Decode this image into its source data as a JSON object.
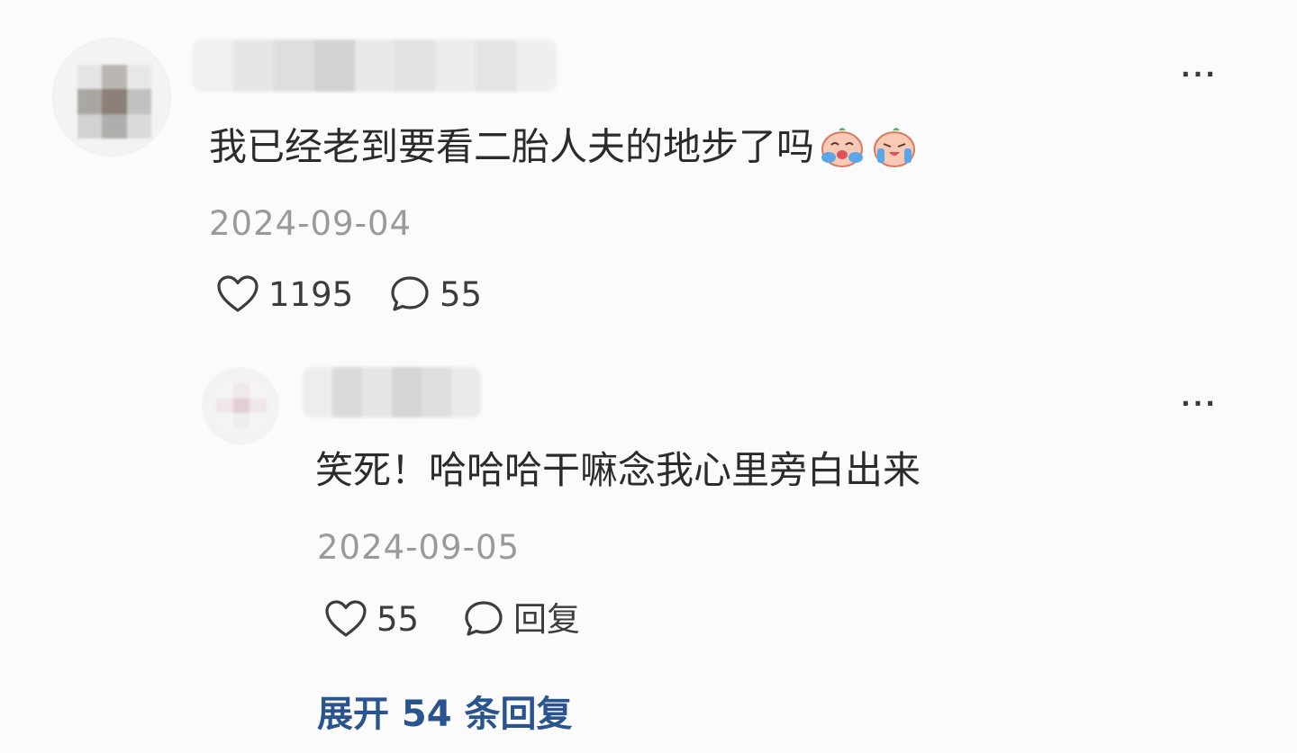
{
  "comment": {
    "text": "我已经老到要看二胎人夫的地步了吗",
    "emojis": [
      "crying-face-emoji",
      "crying-face-emoji"
    ],
    "date": "2024-09-04",
    "likes": "1195",
    "replies": "55",
    "more_icon": "..."
  },
  "reply": {
    "text": "笑死！哈哈哈干嘛念我心里旁白出来",
    "date": "2024-09-05",
    "likes": "55",
    "reply_label": "回复",
    "more_icon": "..."
  },
  "expand_label": "展开 54 条回复",
  "colors": {
    "link": "#2a5490",
    "date": "#9a9a9a",
    "text": "#2b2b2b",
    "background": "#fbfbfb"
  }
}
